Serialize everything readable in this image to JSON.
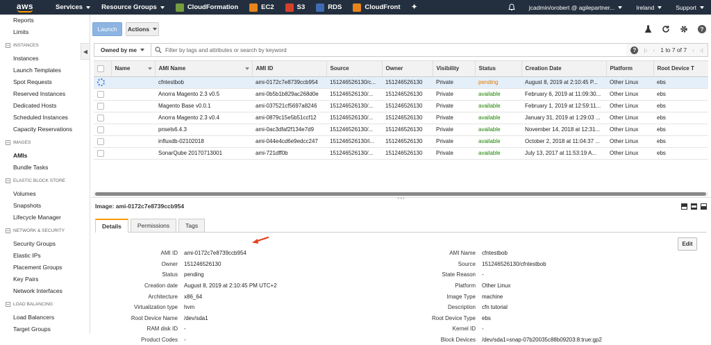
{
  "topnav": {
    "logo": "aws",
    "services": "Services",
    "resource_groups": "Resource Groups",
    "shortcuts": [
      {
        "label": "CloudFormation",
        "color": "#759c3e",
        "icon": "cloudformation-icon"
      },
      {
        "label": "EC2",
        "color": "#e8851a",
        "icon": "ec2-icon"
      },
      {
        "label": "S3",
        "color": "#d6412d",
        "icon": "s3-icon"
      },
      {
        "label": "RDS",
        "color": "#3f6bb5",
        "icon": "rds-icon"
      },
      {
        "label": "CloudFront",
        "color": "#e8851a",
        "icon": "cloudfront-icon"
      }
    ],
    "account": "jcadmin/orobert @ agilepartner...",
    "region": "Ireland",
    "support": "Support"
  },
  "sidebar": {
    "top_items": [
      "Reports",
      "Limits"
    ],
    "sections": [
      {
        "title": "INSTANCES",
        "items": [
          "Instances",
          "Launch Templates",
          "Spot Requests",
          "Reserved Instances",
          "Dedicated Hosts",
          "Scheduled Instances",
          "Capacity Reservations"
        ]
      },
      {
        "title": "IMAGES",
        "items": [
          "AMIs",
          "Bundle Tasks"
        ]
      },
      {
        "title": "ELASTIC BLOCK STORE",
        "items": [
          "Volumes",
          "Snapshots",
          "Lifecycle Manager"
        ]
      },
      {
        "title": "NETWORK & SECURITY",
        "items": [
          "Security Groups",
          "Elastic IPs",
          "Placement Groups",
          "Key Pairs",
          "Network Interfaces"
        ]
      },
      {
        "title": "LOAD BALANCING",
        "items": [
          "Load Balancers",
          "Target Groups"
        ]
      }
    ],
    "active": "AMIs"
  },
  "toolbar": {
    "launch": "Launch",
    "actions": "Actions"
  },
  "filter": {
    "owned_by": "Owned by me",
    "placeholder": "Filter by tags and attributes or search by keyword",
    "pager": "1 to 7 of 7"
  },
  "table": {
    "columns": [
      "Name",
      "AMI Name",
      "AMI ID",
      "Source",
      "Owner",
      "Visibility",
      "Status",
      "Creation Date",
      "Platform",
      "Root Device T"
    ],
    "rows": [
      {
        "name": "",
        "ami_name": "cfntestbob",
        "ami_id": "ami-0172c7e8739ccb954",
        "source": "151246526130/c...",
        "owner": "151246526130",
        "visibility": "Private",
        "status": "pending",
        "date": "August 8, 2019 at 2:10:45 P...",
        "platform": "Other Linux",
        "root": "ebs"
      },
      {
        "name": "",
        "ami_name": "Anorra Magento 2.3 v0.5",
        "ami_id": "ami-0b5b1b829ac268d0e",
        "source": "151246526130/...",
        "owner": "151246526130",
        "visibility": "Private",
        "status": "available",
        "date": "February 6, 2019 at 11:09:30...",
        "platform": "Other Linux",
        "root": "ebs"
      },
      {
        "name": "",
        "ami_name": "Magento Base v0.0.1",
        "ami_id": "ami-037521cf5697a8246",
        "source": "151246526130/...",
        "owner": "151246526130",
        "visibility": "Private",
        "status": "available",
        "date": "February 1, 2019 at 12:59:11...",
        "platform": "Other Linux",
        "root": "ebs"
      },
      {
        "name": "",
        "ami_name": "Anorra Magento 2.3 v0.4",
        "ami_id": "ami-0879c15e5b51ccf12",
        "source": "151246526130/...",
        "owner": "151246526130",
        "visibility": "Private",
        "status": "available",
        "date": "January 31, 2019 at 1:29:03 ...",
        "platform": "Other Linux",
        "root": "ebs"
      },
      {
        "name": "",
        "ami_name": "pnsels6.4.3",
        "ami_id": "ami-0ac3dfaf2f134e7d9",
        "source": "151246526130/...",
        "owner": "151246526130",
        "visibility": "Private",
        "status": "available",
        "date": "November 14, 2018 at 12:31...",
        "platform": "Other Linux",
        "root": "ebs"
      },
      {
        "name": "",
        "ami_name": "influxdb-02102018",
        "ami_id": "ami-044e4cd6e9edcc247",
        "source": "151246526130/i...",
        "owner": "151246526130",
        "visibility": "Private",
        "status": "available",
        "date": "October 2, 2018 at 11:04:37 ...",
        "platform": "Other Linux",
        "root": "ebs"
      },
      {
        "name": "",
        "ami_name": "SonarQube 20170713001",
        "ami_id": "ami-721dff0b",
        "source": "151246526130/...",
        "owner": "151246526130",
        "visibility": "Private",
        "status": "available",
        "date": "July 13, 2017 at 11:53:19 A...",
        "platform": "Other Linux",
        "root": "ebs"
      }
    ]
  },
  "detail": {
    "title": "Image: ami-0172c7e8739ccb954",
    "tabs": [
      "Details",
      "Permissions",
      "Tags"
    ],
    "edit": "Edit",
    "left": [
      {
        "k": "AMI ID",
        "v": "ami-0172c7e8739ccb954"
      },
      {
        "k": "Owner",
        "v": "151246526130"
      },
      {
        "k": "Status",
        "v": "pending"
      },
      {
        "k": "Creation date",
        "v": "August 8, 2019 at 2:10:45 PM UTC+2"
      },
      {
        "k": "Architecture",
        "v": "x86_64"
      },
      {
        "k": "Virtualization type",
        "v": "hvm"
      },
      {
        "k": "Root Device Name",
        "v": "/dev/sda1"
      },
      {
        "k": "RAM disk ID",
        "v": "-"
      },
      {
        "k": "Product Codes",
        "v": "-"
      }
    ],
    "right": [
      {
        "k": "AMI Name",
        "v": "cfntestbob"
      },
      {
        "k": "Source",
        "v": "151246526130/cfntestbob"
      },
      {
        "k": "State Reason",
        "v": "-"
      },
      {
        "k": "Platform",
        "v": "Other Linux"
      },
      {
        "k": "Image Type",
        "v": "machine"
      },
      {
        "k": "Description",
        "v": "cfn tutorial"
      },
      {
        "k": "Root Device Type",
        "v": "ebs"
      },
      {
        "k": "Kernel ID",
        "v": "-"
      },
      {
        "k": "Block Devices",
        "v": "/dev/sda1=snap-07b20035c88b09203:8:true:gp2"
      }
    ]
  },
  "colors": {
    "accent": "#ff9900",
    "nav_bg": "#232f3e",
    "pending": "#e07b00",
    "available": "#1d8102",
    "selected_row": "#e4effa",
    "annotation_arrow": "#e8401c"
  }
}
